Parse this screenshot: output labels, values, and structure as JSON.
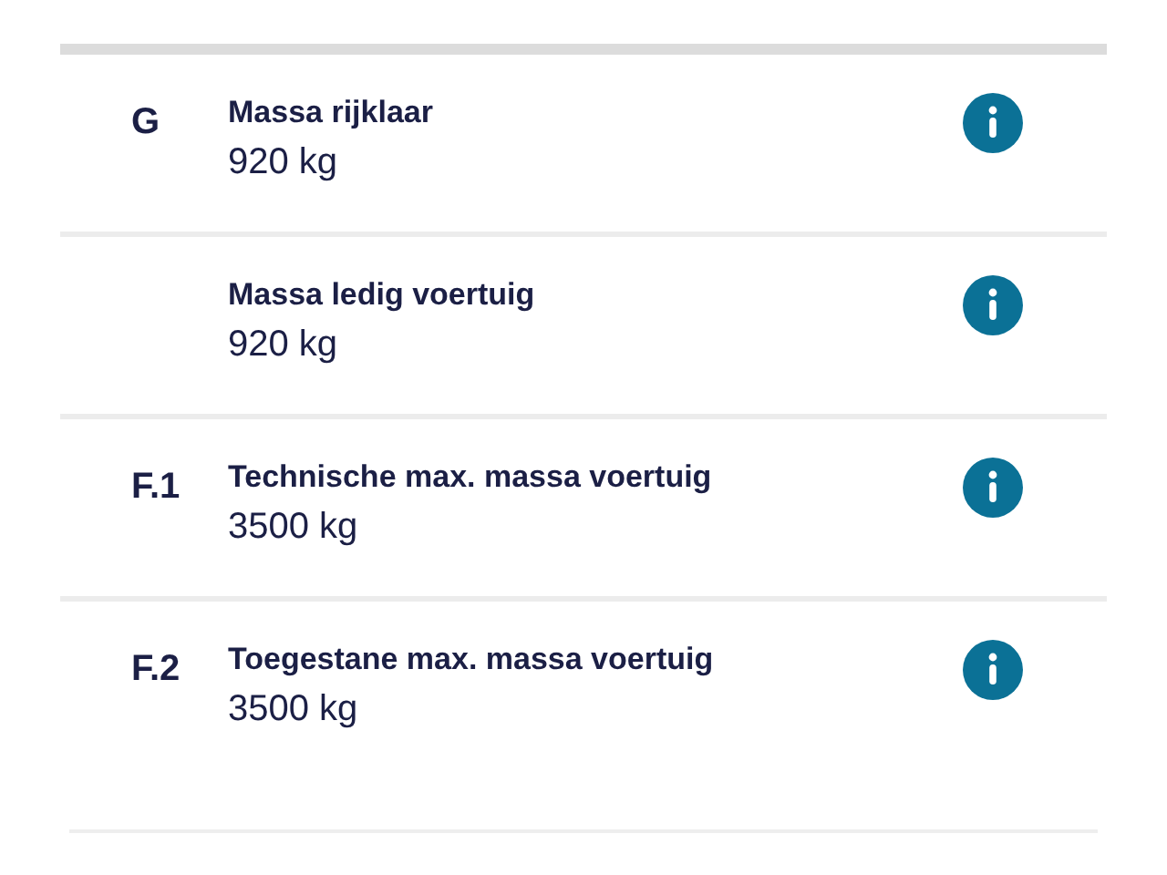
{
  "rows": [
    {
      "code": "G",
      "label": "Massa rijklaar",
      "value": "920 kg"
    },
    {
      "label": "Massa ledig voertuig",
      "value": "920 kg"
    },
    {
      "code": "F.1",
      "label": "Technische max. massa voertuig",
      "value": "3500 kg"
    },
    {
      "code": "F.2",
      "label": "Toegestane max. massa voertuig",
      "value": "3500 kg"
    }
  ]
}
